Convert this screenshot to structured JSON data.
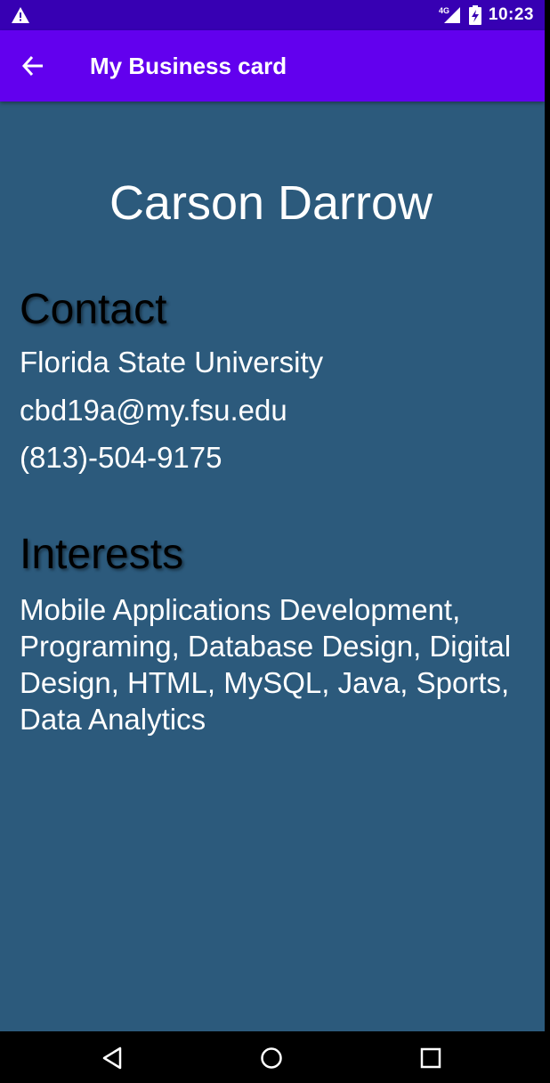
{
  "status_bar": {
    "time": "10:23",
    "network_label": "4G",
    "icons": [
      "warning-icon",
      "signal-icon",
      "battery-icon"
    ]
  },
  "app_bar": {
    "title": "My Business card",
    "back_icon": "arrow-back-icon"
  },
  "card": {
    "name": "Carson Darrow",
    "contact_heading": "Contact",
    "contact_lines": [
      "Florida State University",
      "cbd19a@my.fsu.edu",
      "(813)-504-9175"
    ],
    "interests_heading": "Interests",
    "interests_text": "Mobile Applications Development, Programing, Database Design, Digital Design, HTML, MySQL, Java, Sports, Data Analytics"
  },
  "nav_bar": {
    "icons": [
      "back-triangle-icon",
      "home-circle-icon",
      "recents-square-icon"
    ]
  },
  "colors": {
    "status_bar": "#3700b3",
    "app_bar": "#6200ee",
    "background": "#2c5a7c",
    "heading_text": "#000000",
    "body_text": "#ffffff"
  }
}
